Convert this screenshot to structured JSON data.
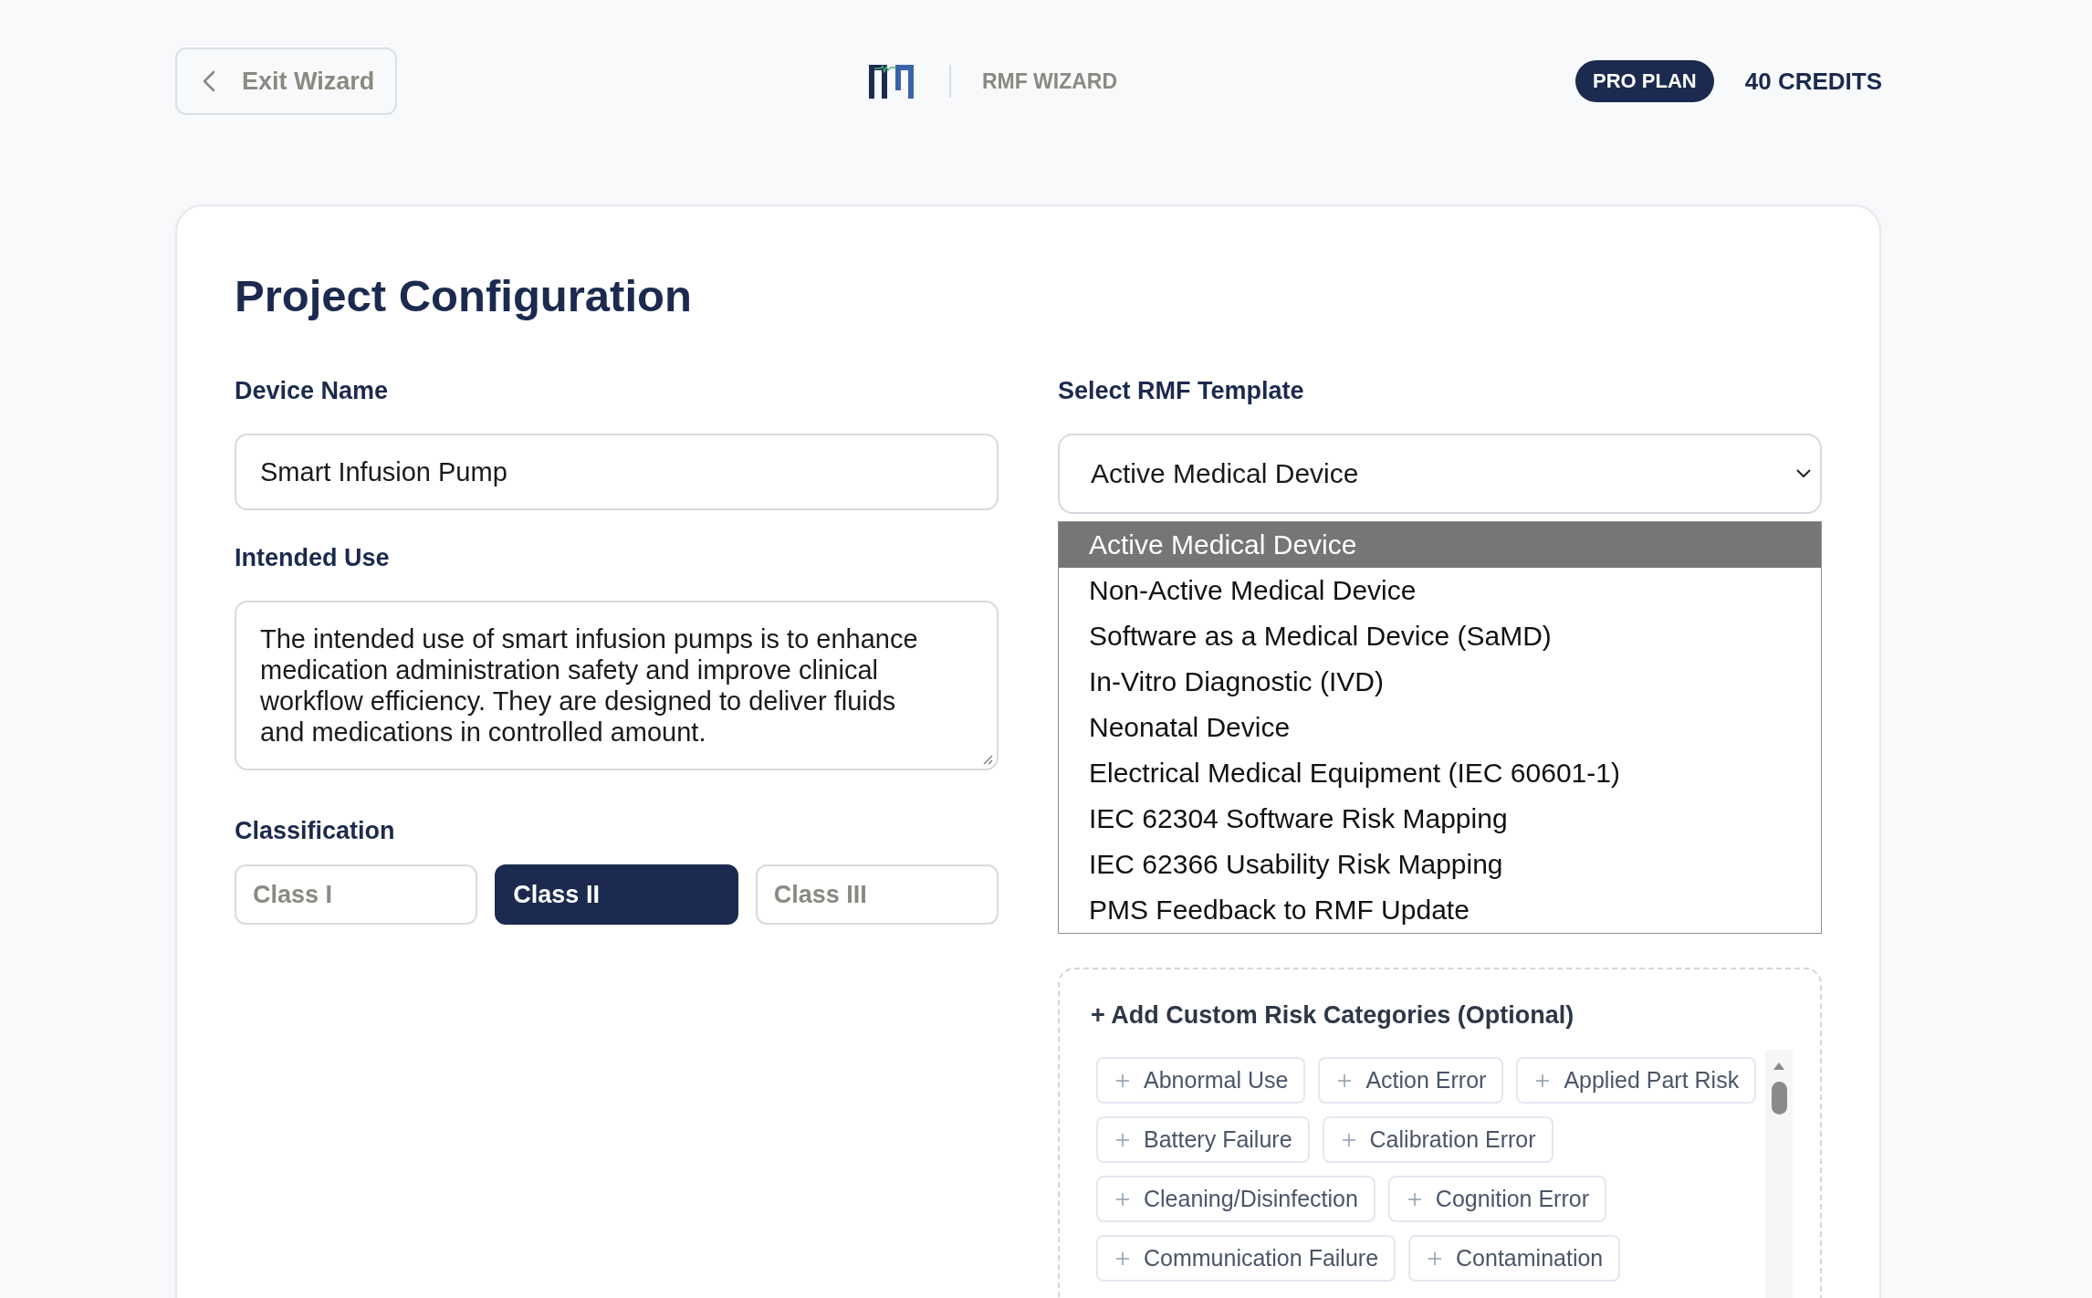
{
  "header": {
    "back_button": "Exit Wizard",
    "app_name": "RMF WIZARD",
    "plan_badge": "PRO PLAN",
    "credits": "40 CREDITS"
  },
  "page_title": "Project Configuration",
  "device_name": {
    "label": "Device Name",
    "value": "Smart Infusion Pump"
  },
  "intended_use": {
    "label": "Intended Use",
    "value": "The intended use of smart infusion pumps is to enhance medication administration safety and improve clinical workflow efficiency. They are designed to deliver fluids and medications in controlled amount."
  },
  "classification": {
    "label": "Classification",
    "options": [
      {
        "label": "Class I",
        "selected": false
      },
      {
        "label": "Class II",
        "selected": true
      },
      {
        "label": "Class III",
        "selected": false
      }
    ]
  },
  "template": {
    "label": "Select RMF Template",
    "value": "Active Medical Device",
    "expanded": true,
    "options": [
      {
        "label": "Active Medical Device",
        "selected": true
      },
      {
        "label": "Non-Active Medical Device",
        "selected": false
      },
      {
        "label": "Software as a Medical Device (SaMD)",
        "selected": false
      },
      {
        "label": "In-Vitro Diagnostic (IVD)",
        "selected": false
      },
      {
        "label": "Neonatal Device",
        "selected": false
      },
      {
        "label": "Electrical Medical Equipment (IEC 60601-1)",
        "selected": false
      },
      {
        "label": "IEC 62304 Software Risk Mapping",
        "selected": false
      },
      {
        "label": "IEC 62366 Usability Risk Mapping",
        "selected": false
      },
      {
        "label": "PMS Feedback to RMF Update",
        "selected": false
      }
    ]
  },
  "custom_risks": {
    "title": "+ Add Custom Risk Categories (Optional)",
    "chips": [
      "Abnormal Use",
      "Action Error",
      "Applied Part Risk",
      "Battery Failure",
      "Calibration Error",
      "Cleaning/Disinfection",
      "Cognition Error",
      "Communication Failure",
      "Contamination"
    ]
  }
}
